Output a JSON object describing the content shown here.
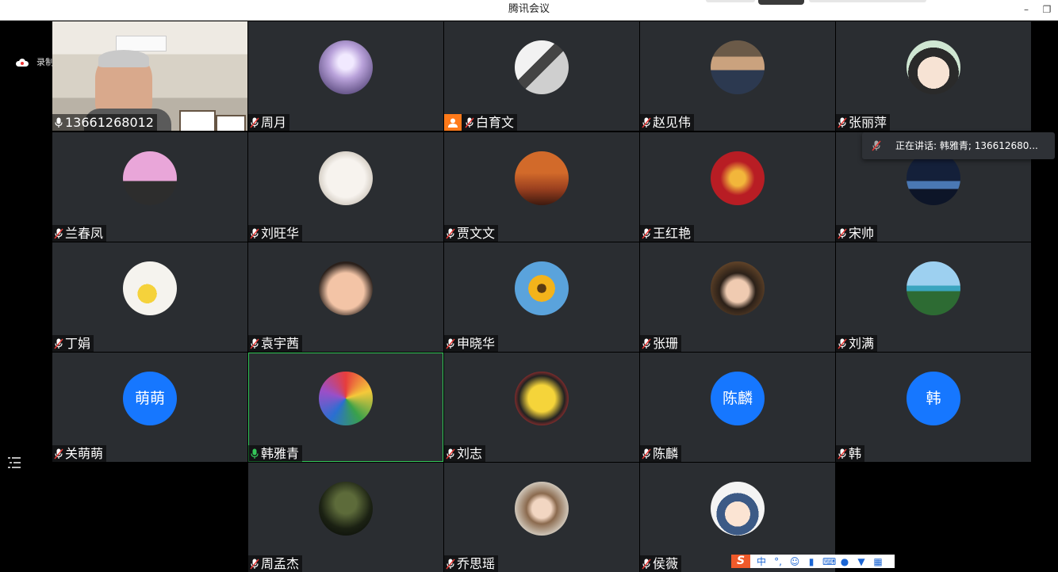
{
  "window": {
    "title": "腾讯会议",
    "minimize_icon": "minimize-icon",
    "restore_icon": "restore-icon"
  },
  "recording": {
    "label": "录制中",
    "icon": "cloud-record-icon"
  },
  "speaking_tooltip": {
    "text": "正在讲话: 韩雅青; 136612680..."
  },
  "colors": {
    "tile_bg": "#2a2d31",
    "avatar_text_bg": "#1677ff",
    "active_border": "#34c759",
    "mic_muted": "#e53935",
    "mic_active": "#34c759",
    "host_badge": "#ff7a1a"
  },
  "participants": [
    {
      "name": "13661268012",
      "mic": "on-white",
      "avatar": "video"
    },
    {
      "name": "周月",
      "mic": "muted",
      "avatar": "lavender-forest"
    },
    {
      "name": "白育文",
      "mic": "muted",
      "avatar": "bw-portrait",
      "badge": "host"
    },
    {
      "name": "赵见伟",
      "mic": "muted",
      "avatar": "man-bookshelf"
    },
    {
      "name": "张丽萍",
      "mic": "muted",
      "avatar": "cartoon-boy"
    },
    {
      "name": "兰春凤",
      "mic": "muted",
      "avatar": "pink-coat"
    },
    {
      "name": "刘旺华",
      "mic": "muted",
      "avatar": "horse-sketch"
    },
    {
      "name": "贾文文",
      "mic": "muted",
      "avatar": "sunset-sea"
    },
    {
      "name": "王红艳",
      "mic": "muted",
      "avatar": "red-dancer"
    },
    {
      "name": "宋帅",
      "mic": "muted",
      "avatar": "night-stadium"
    },
    {
      "name": "丁娟",
      "mic": "muted",
      "avatar": "cartoon-chick"
    },
    {
      "name": "袁宇茜",
      "mic": "muted",
      "avatar": "baby-face"
    },
    {
      "name": "申晓华",
      "mic": "muted",
      "avatar": "sunflower"
    },
    {
      "name": "张珊",
      "mic": "muted",
      "avatar": "woman-lights"
    },
    {
      "name": "刘满",
      "mic": "muted",
      "avatar": "beach-palms"
    },
    {
      "name": "关萌萌",
      "mic": "muted",
      "avatar": "text",
      "avatar_text": "萌萌"
    },
    {
      "name": "韩雅青",
      "mic": "active",
      "avatar": "colorful-painting",
      "active": true
    },
    {
      "name": "刘志",
      "mic": "muted",
      "avatar": "pikachu"
    },
    {
      "name": "陈麟",
      "mic": "muted",
      "avatar": "text",
      "avatar_text": "陈麟"
    },
    {
      "name": "韩",
      "mic": "muted",
      "avatar": "text",
      "avatar_text": "韩"
    },
    {
      "name": "周孟杰",
      "mic": "muted",
      "avatar": "night-tree"
    },
    {
      "name": "乔思瑶",
      "mic": "muted",
      "avatar": "bear-hat-girl"
    },
    {
      "name": "侯薇",
      "mic": "muted",
      "avatar": "cartoon-girl"
    }
  ],
  "ime_toolbar": {
    "logo": "S",
    "mode": "中",
    "items": [
      "punctuation-icon",
      "emoji-icon",
      "voice-icon",
      "keyboard-icon",
      "user-icon",
      "skin-icon",
      "grid-icon"
    ]
  }
}
